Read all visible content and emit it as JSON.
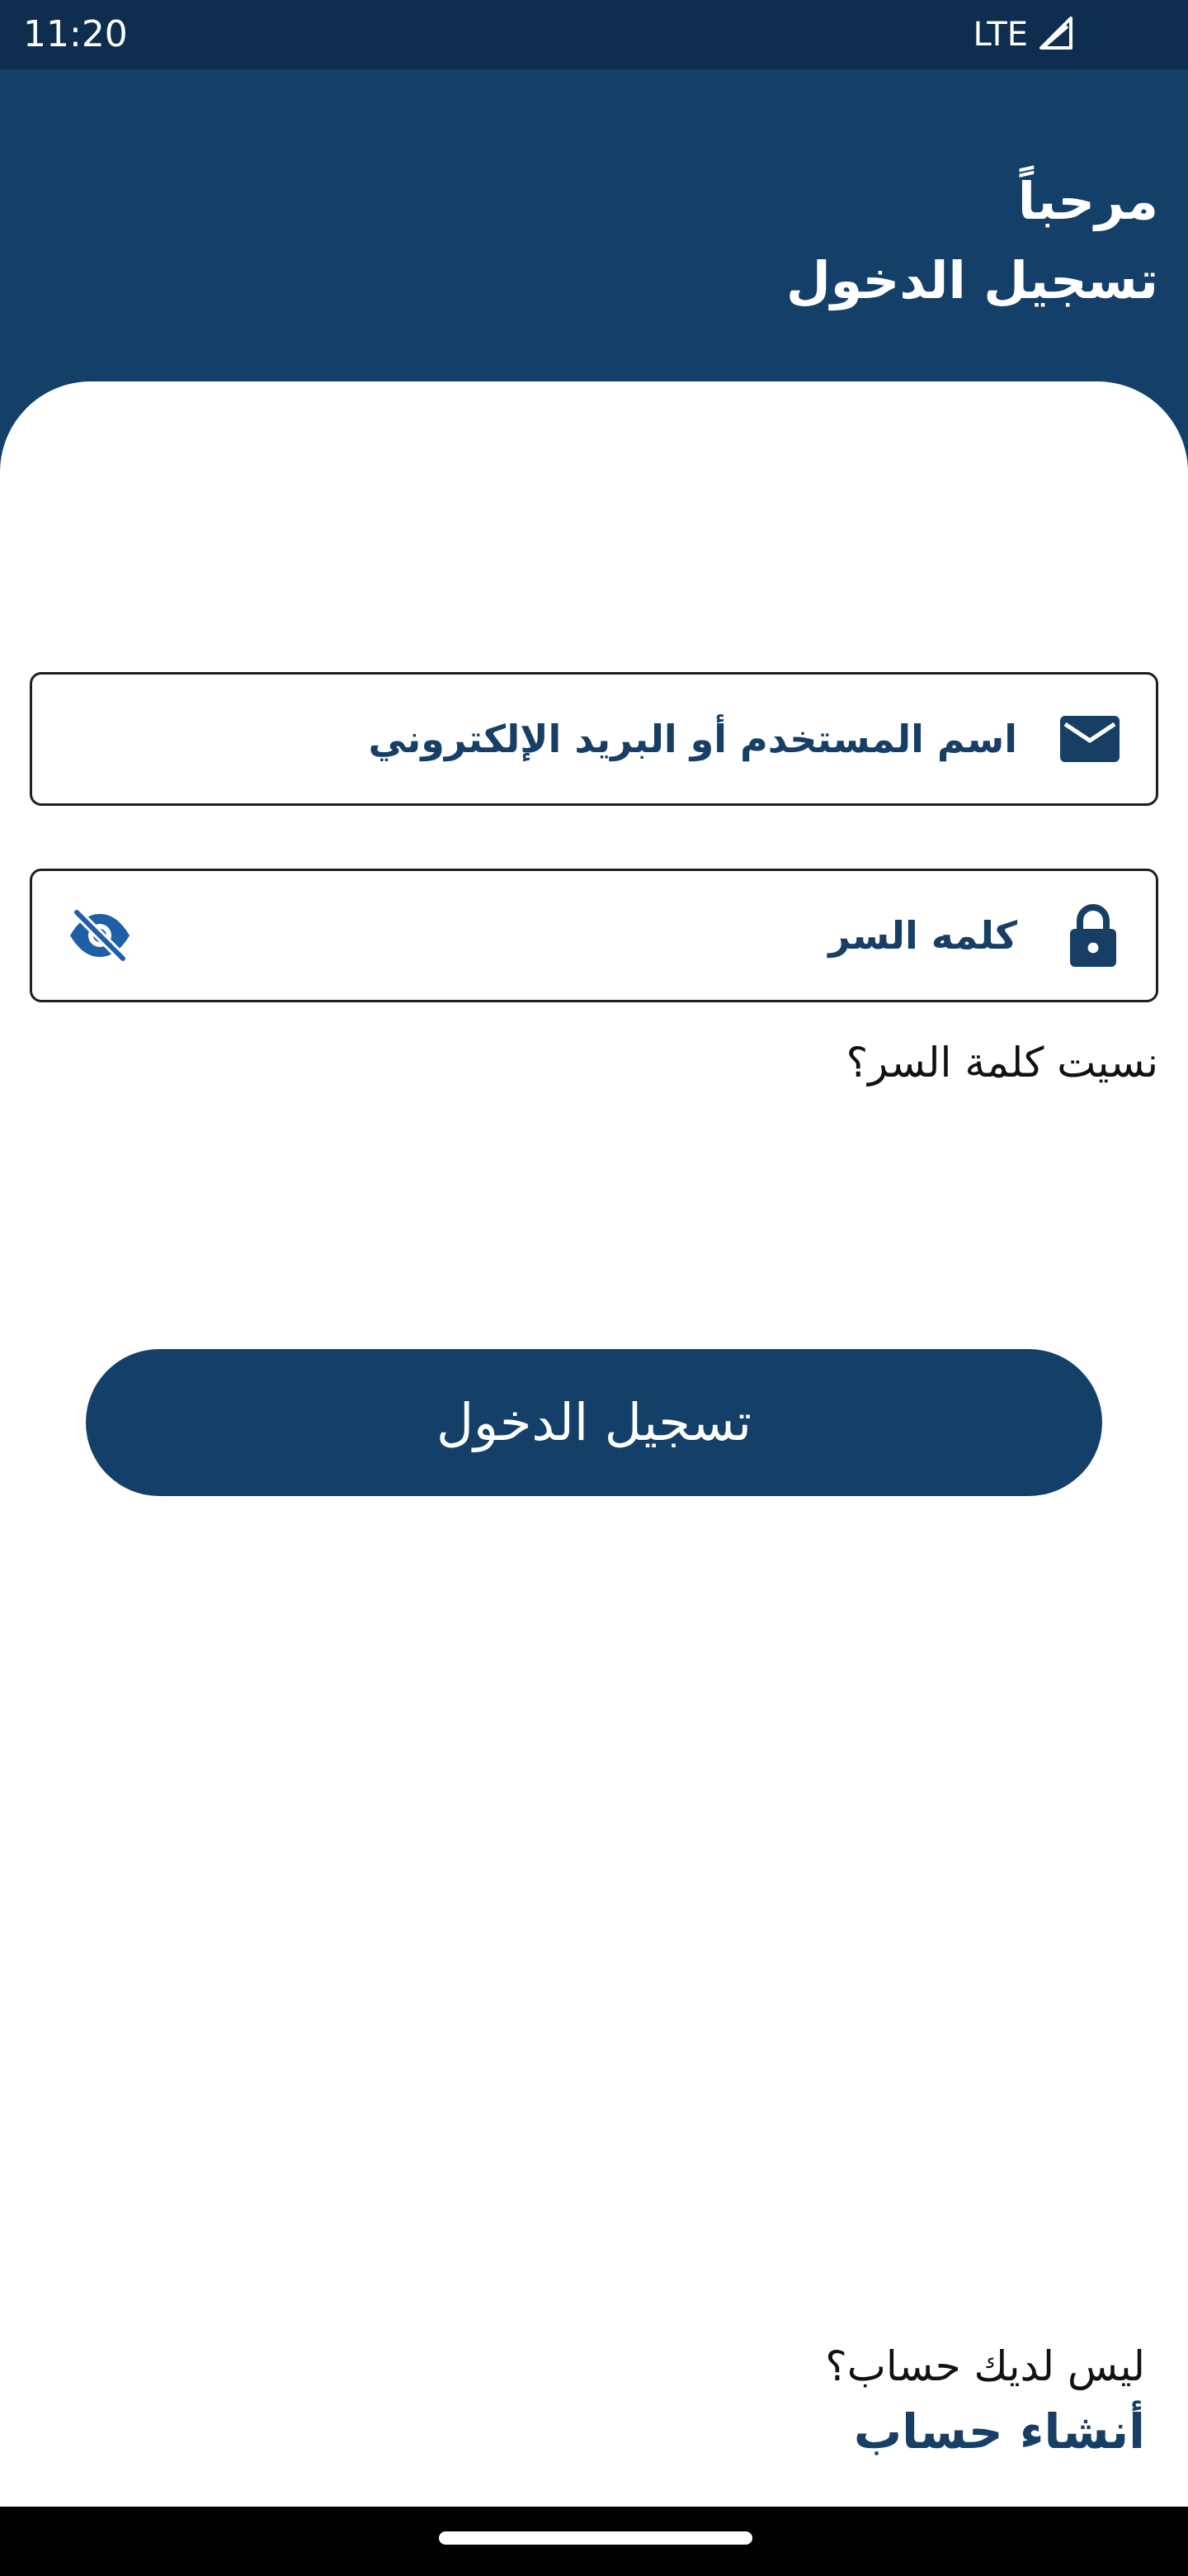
{
  "status_bar": {
    "time": "11:20",
    "network": "LTE",
    "signal_icon": "signal-icon"
  },
  "header": {
    "welcome": "مرحباً",
    "title": "تسجيل الدخول"
  },
  "form": {
    "username": {
      "label": "اسم المستخدم أو البريد الإلكتروني",
      "icon": "mail-icon",
      "value": ""
    },
    "password": {
      "label": "كلمه السر",
      "icon": "lock-icon",
      "toggle_icon": "eye-off-icon",
      "value": ""
    },
    "forgot_password": "نسيت كلمة السر؟",
    "login_button": "تسجيل الدخول"
  },
  "footer": {
    "no_account": "ليس لديك حساب؟",
    "create_account": "أنشاء حساب"
  },
  "colors": {
    "primary": "#133f69",
    "status_bar": "#0e2d4f",
    "icon_blue": "#1f5fa8",
    "text_dark": "#111111",
    "field_border": "#1f1f1f"
  }
}
